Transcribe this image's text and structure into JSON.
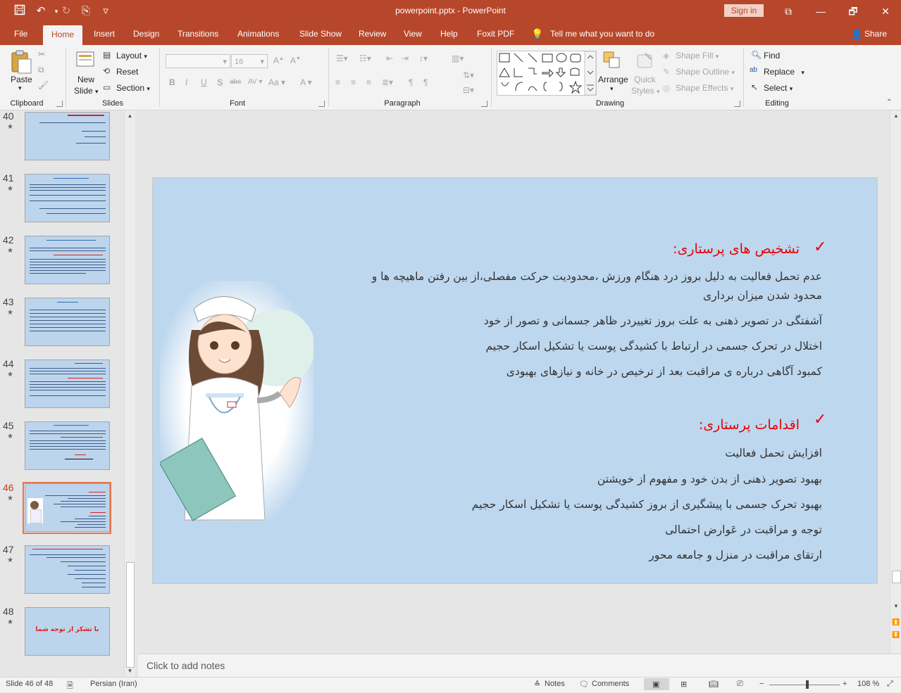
{
  "window": {
    "title": "powerpoint.pptx  -  PowerPoint",
    "sign_in": "Sign in",
    "minimize": "🗕",
    "restore": "🗗",
    "close": "✕",
    "ribbon_display": "⧉"
  },
  "quick_access": {
    "save": "💾",
    "undo": "↶",
    "redo": "↻",
    "present": "⎘",
    "customize": "▿"
  },
  "tabs": [
    "File",
    "Home",
    "Insert",
    "Design",
    "Transitions",
    "Animations",
    "Slide Show",
    "Review",
    "View",
    "Help",
    "Foxit PDF"
  ],
  "tell_me": "Tell me what you want to do",
  "share": "Share",
  "ribbon": {
    "clipboard": {
      "label": "Clipboard",
      "paste": "Paste"
    },
    "slides": {
      "label": "Slides",
      "new_slide_1": "New",
      "new_slide_2": "Slide",
      "layout": "Layout",
      "reset": "Reset",
      "section": "Section"
    },
    "font": {
      "label": "Font",
      "font_name": "",
      "font_size": "16",
      "bold": "B",
      "italic": "I",
      "underline": "U",
      "shadow": "S",
      "strike": "abc",
      "spacing": "AV",
      "grow": "A",
      "shrink": "A",
      "case": "Aa",
      "color": "A"
    },
    "paragraph": {
      "label": "Paragraph"
    },
    "drawing": {
      "label": "Drawing",
      "arrange": "Arrange",
      "quick_styles_1": "Quick",
      "quick_styles_2": "Styles",
      "shape_fill": "Shape Fill",
      "shape_outline": "Shape Outline",
      "shape_effects": "Shape Effects"
    },
    "editing": {
      "label": "Editing",
      "find": "Find",
      "replace": "Replace",
      "select": "Select"
    }
  },
  "thumbnails": [
    {
      "num": "40",
      "star": "★"
    },
    {
      "num": "41",
      "star": "★"
    },
    {
      "num": "42",
      "star": "★"
    },
    {
      "num": "43",
      "star": "★"
    },
    {
      "num": "44",
      "star": "★"
    },
    {
      "num": "45",
      "star": "★"
    },
    {
      "num": "46",
      "star": "★"
    },
    {
      "num": "47",
      "star": "★"
    },
    {
      "num": "48",
      "star": "★"
    }
  ],
  "thumb48_text": "با تشکر از توجه شما",
  "slide": {
    "check1": "✓",
    "heading1": "تشخیص های پرستاری:",
    "diagnoses": [
      "عدم تحمل فعالیت به دلیل بروز درد هنگام ورزش ،محدودیت حرکت مفصلی،از بین رفتن ماهیچه ها و",
      "محدود شدن میزان برداری",
      "آشفتگی در تصویر ذهنی به علت بروز تغییردر ظاهر جسمانی و تصور از خود",
      "اختلال در تحرک جسمی در ارتباط با کشیدگی پوست یا تشکیل اسکار حجیم",
      "کمبود آگاهی درباره ی مراقبت بعد از ترخیص در خانه و نیازهای بهبودی"
    ],
    "check2": "✓",
    "heading2": "اقدامات پرستاری:",
    "actions": [
      "افزایش تحمل فعالیت",
      "بهبود تصویر ذهنی از بدن خود و مفهوم از خویشتن",
      "بهبود تحرک جسمی با پیشگیری از بروز کشیدگی پوست یا تشکیل اسکار حجیم",
      "توجه و مراقبت در عَوارض احتمالی",
      "ارتقای مراقبت در منزل و جامعه محور"
    ]
  },
  "notes_placeholder": "Click to add notes",
  "status": {
    "slide_count": "Slide 46 of 48",
    "language": "Persian (Iran)",
    "notes": "Notes",
    "comments": "Comments",
    "zoom": "108 %",
    "zoom_level": 0.54
  }
}
